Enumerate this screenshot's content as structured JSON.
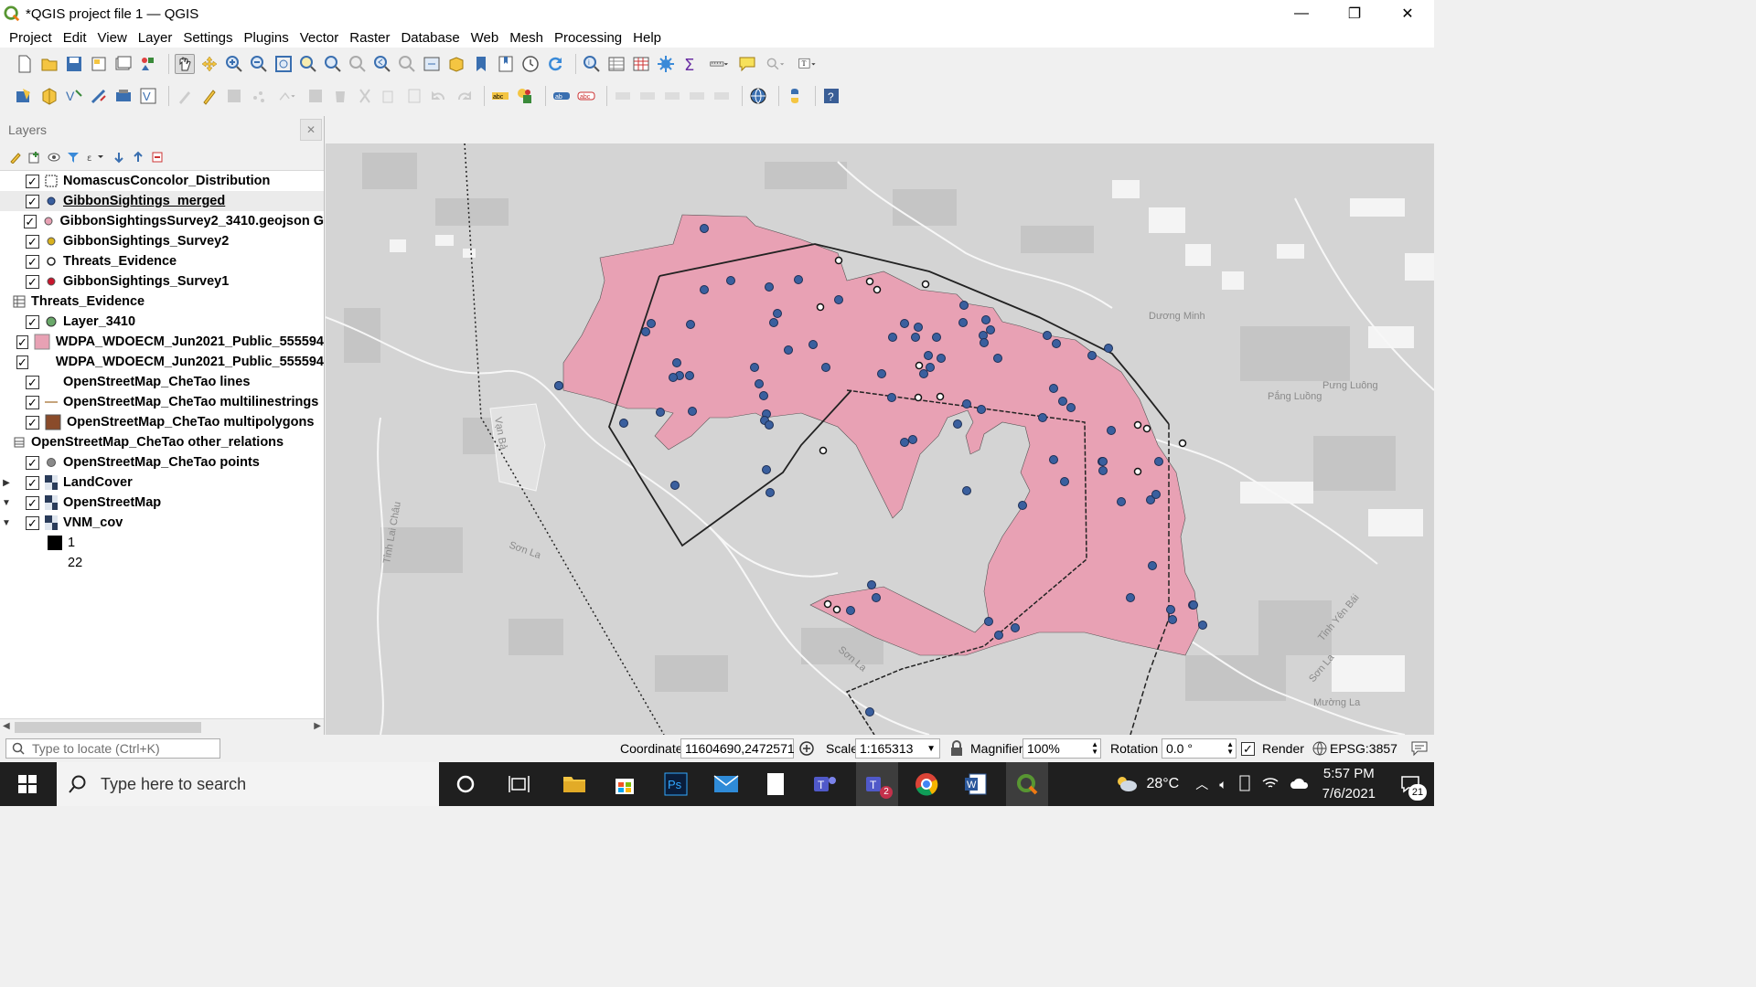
{
  "window": {
    "title": "*QGIS project file 1 — QGIS",
    "controls": {
      "minimize": "—",
      "restore": "❐",
      "close": "✕"
    }
  },
  "menu": [
    "Project",
    "Edit",
    "View",
    "Layer",
    "Settings",
    "Plugins",
    "Vector",
    "Raster",
    "Database",
    "Web",
    "Mesh",
    "Processing",
    "Help"
  ],
  "layers_panel": {
    "title": "Layers",
    "close": "✕",
    "items": [
      {
        "label": "NomascusConcolor_Distribution",
        "checked": true,
        "symbol": "dashed-polygon"
      },
      {
        "label": "GibbonSightings_merged",
        "checked": true,
        "symbol": "blue-point",
        "selected": true
      },
      {
        "label": "GibbonSightingsSurvey2_3410.geojson G",
        "checked": true,
        "symbol": "pink-point"
      },
      {
        "label": "GibbonSightings_Survey2",
        "checked": true,
        "symbol": "yellow-point"
      },
      {
        "label": "Threats_Evidence",
        "checked": true,
        "symbol": "white-point"
      },
      {
        "label": "GibbonSightings_Survey1",
        "checked": true,
        "symbol": "red-point"
      },
      {
        "label": "Threats_Evidence",
        "checked": false,
        "symbol": "table"
      },
      {
        "label": "Layer_3410",
        "checked": true,
        "symbol": "green-point"
      },
      {
        "label": "WDPA_WDOECM_Jun2021_Public_555594",
        "checked": true,
        "symbol": "pink-polygon"
      },
      {
        "label": "WDPA_WDOECM_Jun2021_Public_555594",
        "checked": true,
        "symbol": "white-polygon"
      },
      {
        "label": "OpenStreetMap_CheTao lines",
        "checked": true,
        "symbol": "none"
      },
      {
        "label": "OpenStreetMap_CheTao multilinestrings",
        "checked": true,
        "symbol": "tan-line"
      },
      {
        "label": "OpenStreetMap_CheTao multipolygons",
        "checked": true,
        "symbol": "brown-polygon"
      },
      {
        "label": "OpenStreetMap_CheTao other_relations",
        "checked": false,
        "symbol": "table-small"
      },
      {
        "label": "OpenStreetMap_CheTao points",
        "checked": true,
        "symbol": "grey-point"
      },
      {
        "label": "LandCover",
        "checked": true,
        "symbol": "raster",
        "expander": "collapsed"
      },
      {
        "label": "OpenStreetMap",
        "checked": true,
        "symbol": "raster",
        "expander": "expanded"
      },
      {
        "label": "VNM_cov",
        "checked": true,
        "symbol": "raster",
        "expander": "expanded"
      }
    ],
    "legend": [
      {
        "label": "1",
        "color": "#000000"
      },
      {
        "label": "22",
        "color": "#ffffff"
      }
    ]
  },
  "map": {
    "place_labels": [
      {
        "text": "Dương Minh"
      },
      {
        "text": "Pắng Luồng"
      },
      {
        "text": "Pưng Luông"
      },
      {
        "text": "Sơn La"
      },
      {
        "text": "Sơn La"
      },
      {
        "text": "Tỉnh Yên Bái"
      },
      {
        "text": "Sơn La"
      },
      {
        "text": "Tỉnh Lai Châu"
      },
      {
        "text": "Mường La"
      },
      {
        "text": "Vạn Bả"
      }
    ]
  },
  "status": {
    "locator_placeholder": "Type to locate (Ctrl+K)",
    "coordinate_label": "Coordinate",
    "coordinate_value": "11604690,2472571",
    "scale_label": "Scale",
    "scale_value": "1:165313",
    "magnifier_label": "Magnifier",
    "magnifier_value": "100%",
    "rotation_label": "Rotation",
    "rotation_value": "0.0 °",
    "render_label": "Render",
    "render_checked": true,
    "crs": "EPSG:3857"
  },
  "taskbar": {
    "search_placeholder": "Type here to search",
    "weather": "28°C",
    "time": "5:57 PM",
    "date": "7/6/2021",
    "notifications": "21",
    "teams_badge": "2"
  }
}
